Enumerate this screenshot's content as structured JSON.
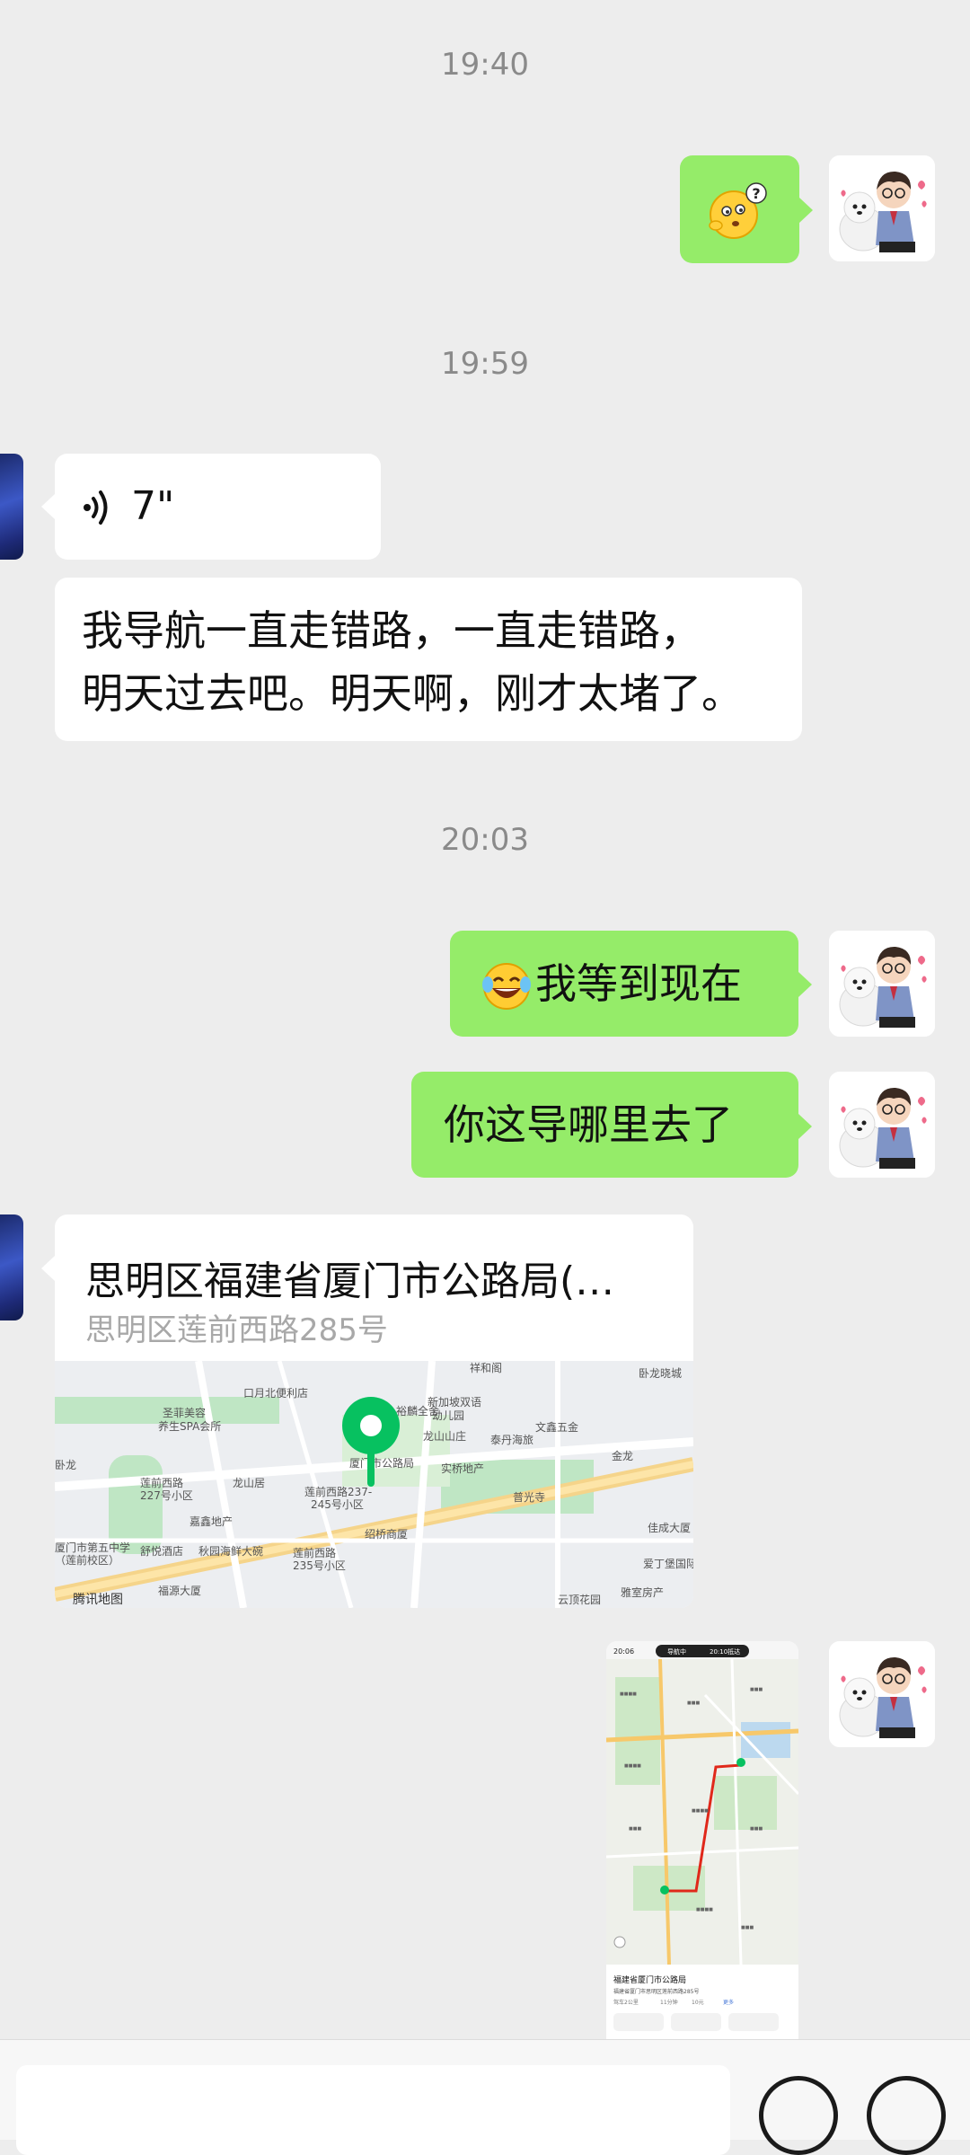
{
  "timestamps": [
    "19:40",
    "19:59",
    "20:03"
  ],
  "messages": {
    "voice_duration": "7\"",
    "text_1_line1": "我导航一直走错路，一直走错路，",
    "text_1_line2": "明天过去吧。明天啊，刚才太堵了。",
    "me_2_text": "我等到现在",
    "me_3_text": "你这导哪里去了"
  },
  "location": {
    "title": "思明区福建省厦门市公路局(…",
    "address": "思明区莲前西路285号",
    "map_labels": [
      "祥和阁",
      "卧龙晓城",
      "口月北便利店",
      "新加坡双语",
      "幼儿园",
      "圣菲美容",
      "养生SPA会所",
      "龙山山庄",
      "文鑫五金",
      "泰丹海旅",
      "金龙",
      "实桥地产",
      "厦门市公路局",
      "龙山居",
      "莲前西路",
      "227号小区",
      "莲前西路237-",
      "245号小区",
      "卧龙",
      "嘉鑫地产",
      "绍桥商厦",
      "厦门市第五中学",
      "（莲前校区）",
      "舒悦酒店",
      "秋园海鲜大碗",
      "莲前西路",
      "235号小区",
      "福源大厦",
      "腾讯地图",
      "普光寺",
      "佳成大厦",
      "云顶花园",
      "雅室房产",
      "裕麟全舍",
      "爱丁堡国际"
    ],
    "map_brand": "腾讯地图"
  },
  "screenshot": {
    "status_time": "20:06",
    "nav_status": "导航中",
    "nav_time": "20:10抵达",
    "dest_name": "福建省厦门市公路局",
    "dest_addr": "福建省厦门市思明区莲前西路285号",
    "dist_info": "驾车2公里",
    "duration": "11分钟",
    "cost": "10元",
    "more": "更多"
  },
  "icons": {
    "voice": "voice-wave-icon",
    "emoji_confused": "confused-face-emoji",
    "emoji_laugh": "tears-of-joy-emoji",
    "map_pin": "location-pin-icon"
  },
  "colors": {
    "my_bubble": "#95ec69",
    "other_bubble": "#ffffff",
    "background": "#ededed",
    "pin": "#07c160",
    "route": "#e0281a"
  }
}
